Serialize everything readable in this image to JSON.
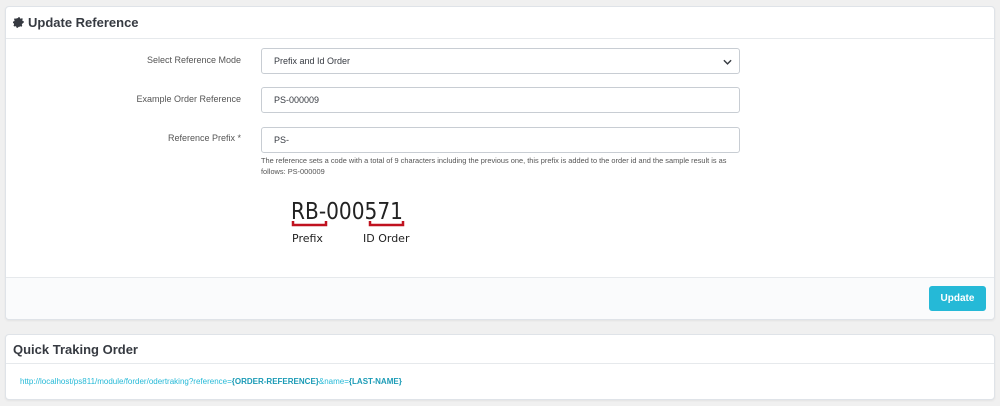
{
  "update_panel": {
    "title": "Update Reference",
    "mode_label": "Select Reference Mode",
    "mode_value": "Prefix and Id Order",
    "example_label": "Example Order Reference",
    "example_value": "PS-000009",
    "prefix_label": "Reference Prefix *",
    "prefix_value": "PS-",
    "help_text": "The reference sets a code with a total of 9 characters including the previous one, this prefix is added to the order id and the sample result is as follows: PS-000009",
    "graphic": {
      "reference": "RB-000571",
      "prefix_caption": "Prefix",
      "id_caption": "ID Order"
    },
    "update_button": "Update"
  },
  "tracking_panel": {
    "title": "Quick Traking Order",
    "url_prefix": "http://localhost/ps811/module/forder/odertraking?reference=",
    "url_ref_token": "{ORDER-REFERENCE}",
    "url_mid": "&name=",
    "url_name_token": "{LAST-NAME}"
  },
  "colors": {
    "accent": "#25b9d7",
    "bracket": "#c0121f"
  },
  "icons": {
    "heading": "gear-icon",
    "select": "chevron-down-icon"
  }
}
